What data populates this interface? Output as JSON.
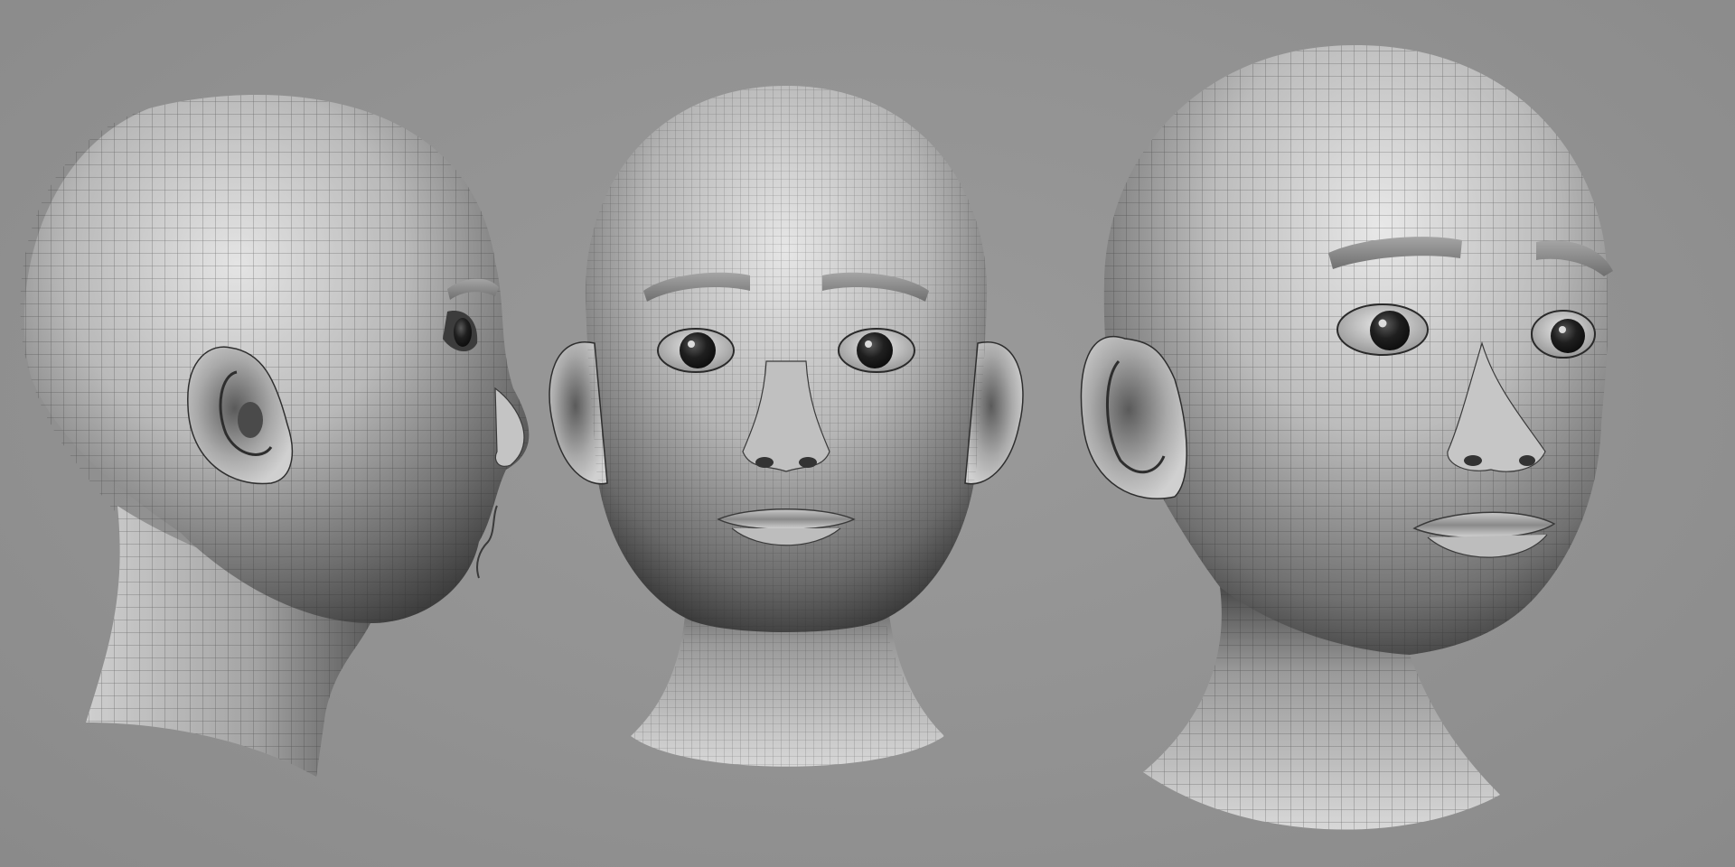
{
  "scene": {
    "subject": "3d-head-wireframe-turnaround",
    "views": [
      {
        "id": "side",
        "name": "side-view-head"
      },
      {
        "id": "front",
        "name": "front-view-head"
      },
      {
        "id": "three-quarter",
        "name": "three-quarter-view-head"
      }
    ],
    "colors": {
      "background": "#8f8f8f",
      "skin_light": "#e2e2e2",
      "skin_mid": "#a8a8a8",
      "skin_dark": "#3a3a3a",
      "wire": "#2b2b2b",
      "brow": "#8c8c8c",
      "eye": "#1a1a1a"
    }
  }
}
